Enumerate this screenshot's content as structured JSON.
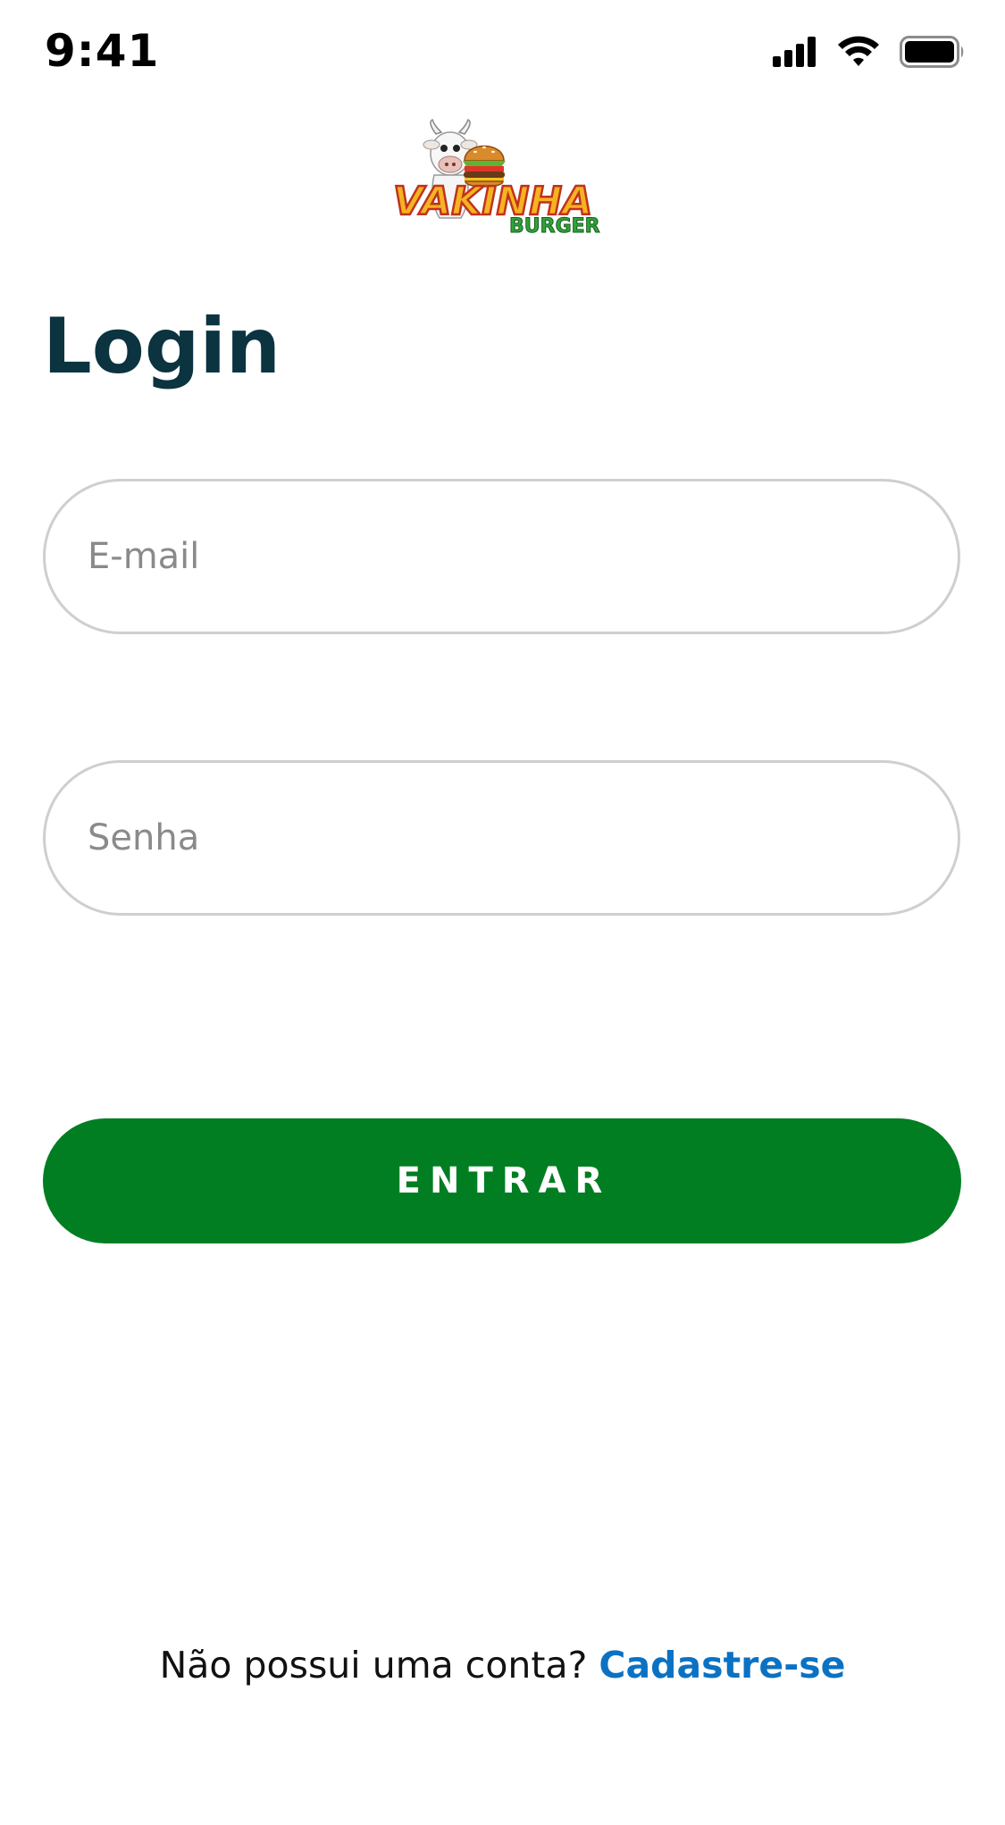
{
  "status_bar": {
    "time": "9:41",
    "icons": [
      "cellular-signal-icon",
      "wifi-icon",
      "battery-icon"
    ]
  },
  "logo": {
    "brand_main": "VAKINHA",
    "brand_sub": "BURGER"
  },
  "page": {
    "title": "Login"
  },
  "form": {
    "email": {
      "placeholder": "E-mail",
      "value": ""
    },
    "password": {
      "placeholder": "Senha",
      "value": ""
    },
    "submit_label": "ENTRAR"
  },
  "footer": {
    "prompt": "Não possui uma conta?",
    "signup_label": "Cadastre-se"
  },
  "colors": {
    "title": "#0b3340",
    "button": "#027e22",
    "link": "#0b72c3",
    "field_border": "#cfcfcf",
    "placeholder": "#8a8a8a"
  }
}
